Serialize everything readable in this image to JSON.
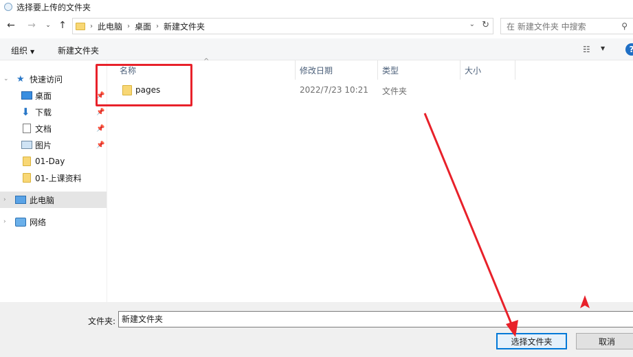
{
  "window": {
    "title": "选择要上传的文件夹"
  },
  "address": {
    "breadcrumbs": [
      "此电脑",
      "桌面",
      "新建文件夹"
    ],
    "search_placeholder": "在 新建文件夹 中搜索"
  },
  "toolbar": {
    "organize": "组织",
    "new_folder": "新建文件夹",
    "help": "?"
  },
  "sidebar": {
    "quick_access": "快速访问",
    "items": [
      "桌面",
      "下载",
      "文档",
      "图片",
      "01-Day",
      "01-上课资料"
    ],
    "this_pc": "此电脑",
    "network": "网络"
  },
  "columns": {
    "name": "名称",
    "modified": "修改日期",
    "type": "类型",
    "size": "大小"
  },
  "files": [
    {
      "name": "pages",
      "modified": "2022/7/23 10:21",
      "type": "文件夹",
      "size": ""
    }
  ],
  "footer": {
    "folder_label": "文件夹:",
    "folder_value": "新建文件夹",
    "select_button": "选择文件夹",
    "cancel_button": "取消"
  },
  "colors": {
    "annotation": "#e8212a",
    "accent": "#0078d7",
    "folder": "#f8d775"
  }
}
